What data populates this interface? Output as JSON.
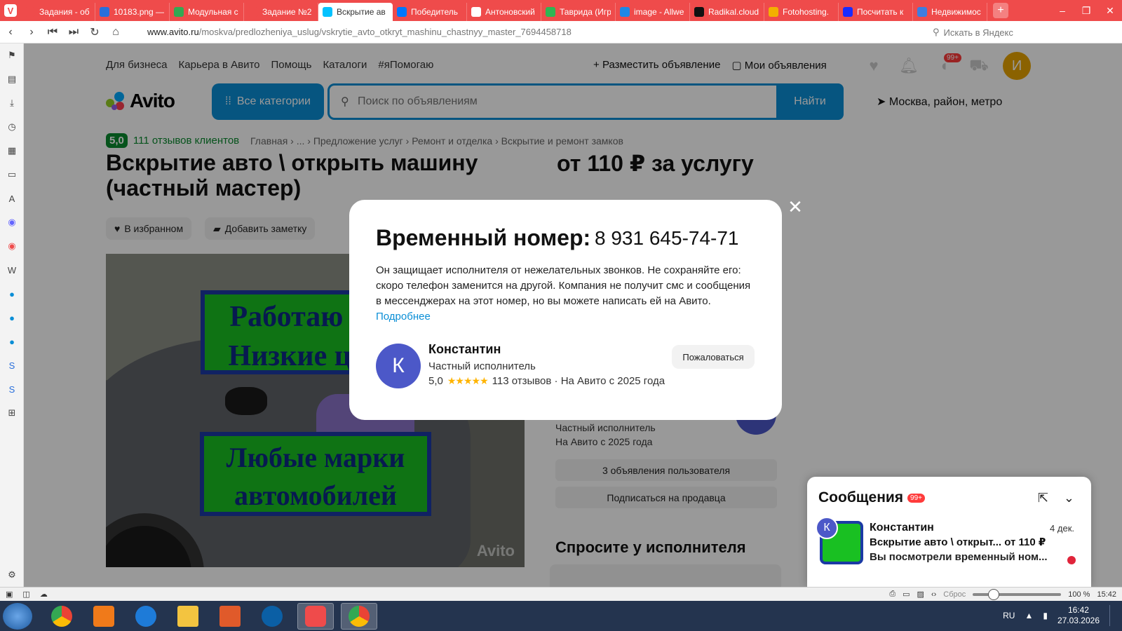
{
  "browser": {
    "tabs": [
      {
        "label": "Задания - об",
        "color": "#ef4b4b"
      },
      {
        "label": "10183.png —",
        "color": "#2a6fdb"
      },
      {
        "label": "Модульная с",
        "color": "#34a853"
      },
      {
        "label": "Задание №2",
        "color": "#ef4b4b"
      },
      {
        "label": "Вскрытие ав",
        "color": "#04c2ff",
        "active": true
      },
      {
        "label": "Победитель",
        "color": "#0077ff"
      },
      {
        "label": "Антоновский",
        "color": "#ffffff"
      },
      {
        "label": "Таврида (Игр",
        "color": "#2fb553"
      },
      {
        "label": "image - Allwe",
        "color": "#1e88e5"
      },
      {
        "label": "Radikal.cloud",
        "color": "#111111"
      },
      {
        "label": "Fotohosting.",
        "color": "#f3b000"
      },
      {
        "label": "Посчитать к",
        "color": "#1a2bff"
      },
      {
        "label": "Недвижимос",
        "color": "#3f7de0"
      }
    ],
    "url_host": "www.avito.ru",
    "url_path": "/moskva/predlozheniya_uslug/vskrytie_avto_otkryt_mashinu_chastnyy_master_7694458718",
    "search_placeholder": "Искать в Яндекс"
  },
  "header": {
    "nav_left": [
      "Для бизнеса",
      "Карьера в Авито",
      "Помощь",
      "Каталоги",
      "#яПомогаю"
    ],
    "post_ad": "Разместить объявление",
    "my_ads": "Мои объявления",
    "messages_badge": "99+",
    "user_initial": "И",
    "logo": "Avito",
    "all_categories": "Все категории",
    "search_placeholder": "Поиск по объявлениям",
    "find": "Найти",
    "location": "Москва, район, метро"
  },
  "listing": {
    "rating_value": "5,0",
    "rating_text": "111 отзывов клиентов",
    "breadcrumbs": "Главная › ... › Предложение услуг › Ремонт и отделка › Вскрытие и ремонт замков",
    "title": "Вскрытие авто \\ открыть машину (частный мастер)",
    "price": "от 110 ₽ за услугу",
    "favorite": "В избранном",
    "add_note": "Добавить заметку",
    "photo_text_1": "Работаю 24/7 Низкие цены",
    "photo_text_2": "Любые марки автомобилей",
    "photo_watermark": "Avito",
    "seller_type": "Частный исполнитель",
    "seller_since": "На Авито с 2025 года",
    "user_ads": "3 объявления пользователя",
    "subscribe": "Подписаться на продавца",
    "ask_title": "Спросите у исполнителя"
  },
  "modal": {
    "title": "Временный номер:",
    "phone": "8 931 645-74-71",
    "description": "Он защищает исполнителя от нежелательных звонков. Не сохраняйте его: скоро телефон заменится на другой. Компания не получит смс и сообщения в мессенджерах на этот номер, но вы можете написать ей на Авито.",
    "more_link": "Подробнее",
    "seller_initial": "К",
    "seller_name": "Константин",
    "seller_role": "Частный исполнитель",
    "seller_rating": "5,0",
    "seller_stars": "★★★★★",
    "seller_meta": "113 отзывов · На Авито с 2025 года",
    "report": "Пожаловаться",
    "close_glyph": "✕"
  },
  "messages": {
    "title": "Сообщения",
    "badge": "99+",
    "chat_initial": "К",
    "chat_name": "Константин",
    "chat_date": "4 дек.",
    "chat_line1": "Вскрытие авто \\ открыт... от 110 ₽",
    "chat_line2": "Вы посмотрели временный ном..."
  },
  "statusbar": {
    "reset": "Сброс",
    "zoom": "100 %",
    "time": "15:42"
  },
  "taskbar": {
    "lang": "RU",
    "time": "16:42",
    "date": "27.03.2026"
  },
  "colors": {
    "vivaldi_red": "#ef4b4b",
    "avito_blue": "#0a8ed6",
    "rating_green": "#0a8a2f",
    "avatar_purple": "#4c58c8"
  }
}
